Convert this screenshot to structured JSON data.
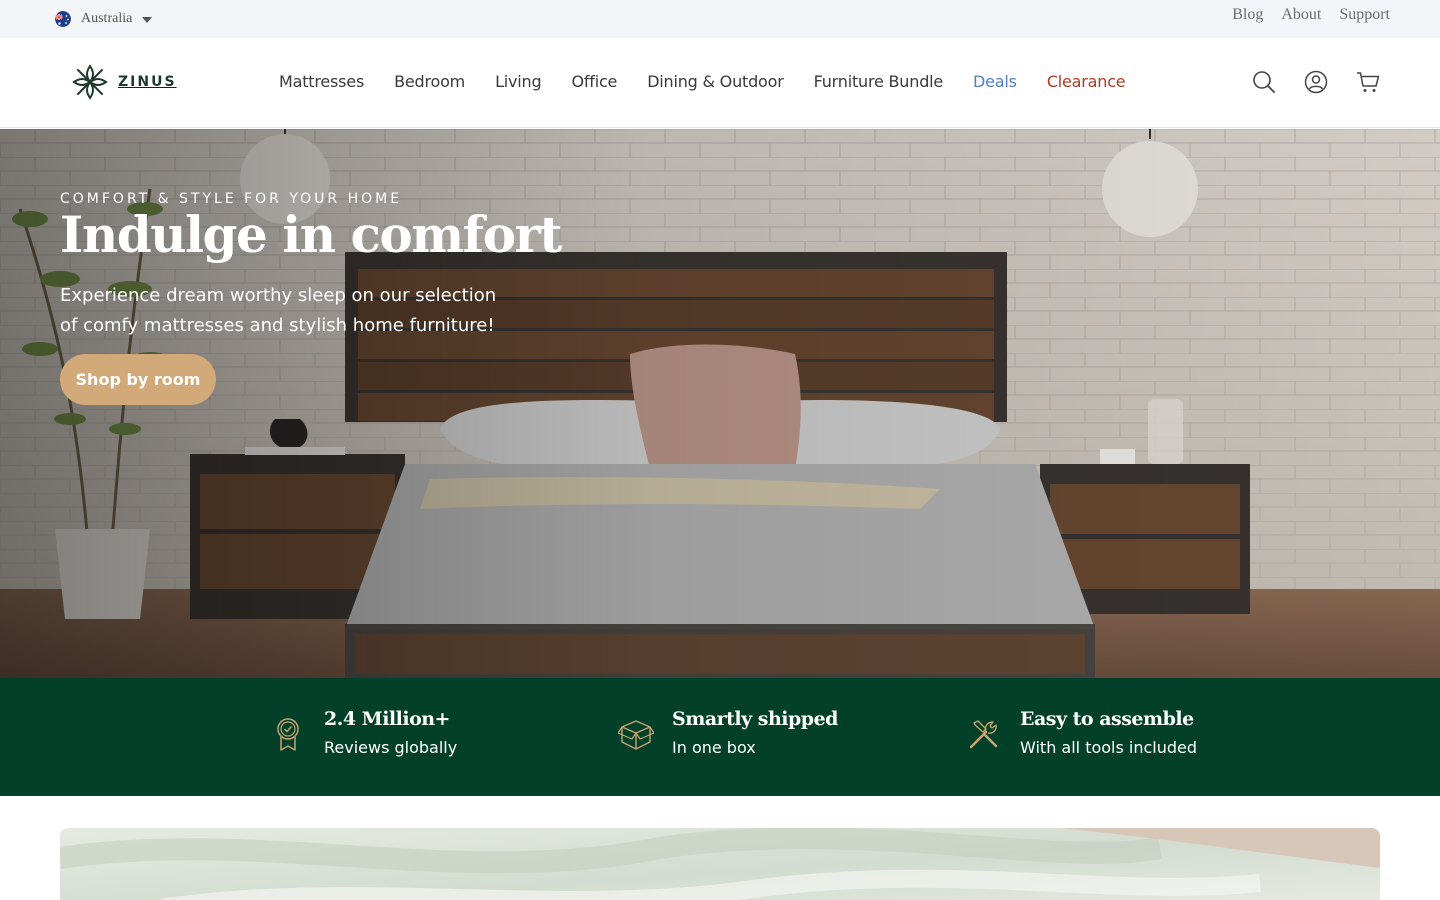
{
  "topbar": {
    "region": "Australia",
    "links": [
      "Blog",
      "About",
      "Support"
    ]
  },
  "header": {
    "logo_text": "ZINUS",
    "nav": [
      {
        "label": "Mattresses"
      },
      {
        "label": "Bedroom"
      },
      {
        "label": "Living"
      },
      {
        "label": "Office"
      },
      {
        "label": "Dining & Outdoor"
      },
      {
        "label": "Furniture Bundle"
      },
      {
        "label": "Deals"
      },
      {
        "label": "Clearance"
      }
    ],
    "icons": [
      "search-icon",
      "account-icon",
      "cart-icon"
    ]
  },
  "hero": {
    "eyebrow": "COMFORT & STYLE FOR YOUR HOME",
    "title": "Indulge in comfort",
    "subtitle_line1": "Experience dream worthy sleep on our selection",
    "subtitle_line2": "of comfy mattresses and stylish home furniture!",
    "cta": "Shop by room"
  },
  "features": [
    {
      "icon": "award-ribbon-icon",
      "title": "2.4 Million+",
      "subtitle": "Reviews globally"
    },
    {
      "icon": "box-icon",
      "title": "Smartly shipped",
      "subtitle": "In one box"
    },
    {
      "icon": "tools-icon",
      "title": "Easy to assemble",
      "subtitle": "With all tools included"
    }
  ],
  "colors": {
    "deals": "#4f7fc4",
    "clearance": "#b0391f",
    "cta": "#d2a979",
    "feature_band": "#03402a"
  }
}
